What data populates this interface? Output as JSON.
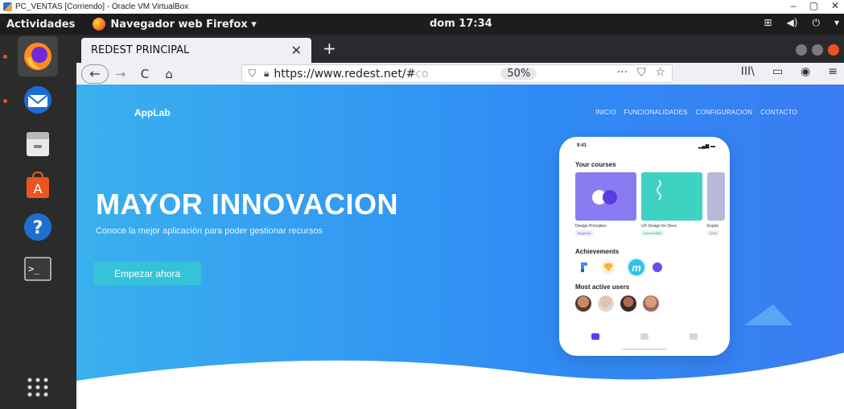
{
  "vbox": {
    "title": "PC_VENTAS [Corriendo] - Oracle VM VirtualBox",
    "minimize": "–",
    "restore": "▢",
    "close": "✕"
  },
  "gnome": {
    "activities": "Actividades",
    "app_label": "Navegador web Firefox ▾",
    "clock": "dom 17:34",
    "tray": [
      "⊞",
      "◀)",
      "⏻",
      "▾"
    ]
  },
  "firefox": {
    "tab_title": "REDEST PRINCIPAL",
    "tab_close": "✕",
    "new_tab": "+",
    "nav": {
      "back": "←",
      "forward": "→",
      "reload": "C",
      "home": "⌂"
    },
    "url": {
      "shown": "https://www.redest.net/#co",
      "zoom": "50%"
    },
    "url_actions": [
      "···",
      "⛉",
      "☆"
    ],
    "toolbar": [
      "III\\",
      "▭",
      "◉",
      "≡"
    ],
    "colors": {
      "accent": "#e95420"
    }
  },
  "page": {
    "brand": "AppLab",
    "nav": [
      "INICIO",
      "FUNCIONALIDADES",
      "CONFIGURACION",
      "CONTACTO"
    ],
    "hero_title": "MAYOR INNOVACION",
    "hero_subtitle": "Conoce la mejor aplicación para poder gestionar recursos",
    "cta": "Empezar ahora",
    "colors": {
      "hero_start": "#3ab0ee",
      "hero_end": "#3a7cf2",
      "cta": "#34c3d8"
    }
  },
  "phone": {
    "time": "9:41",
    "status": "▂▄▆ ▬",
    "courses_title": "Your courses",
    "courses": [
      {
        "name": "Design Principles",
        "tag": "Beginner"
      },
      {
        "name": "UX Design for Devs",
        "tag": "Intermediate"
      },
      {
        "name": "Explor",
        "tag": "Adva"
      }
    ],
    "achievements_title": "Achievements",
    "users_title": "Most active users"
  },
  "dock": {
    "items": [
      "firefox-icon",
      "thunderbird-icon",
      "files-icon",
      "software-icon",
      "help-icon",
      "terminal-icon",
      "apps-grid-icon"
    ]
  }
}
